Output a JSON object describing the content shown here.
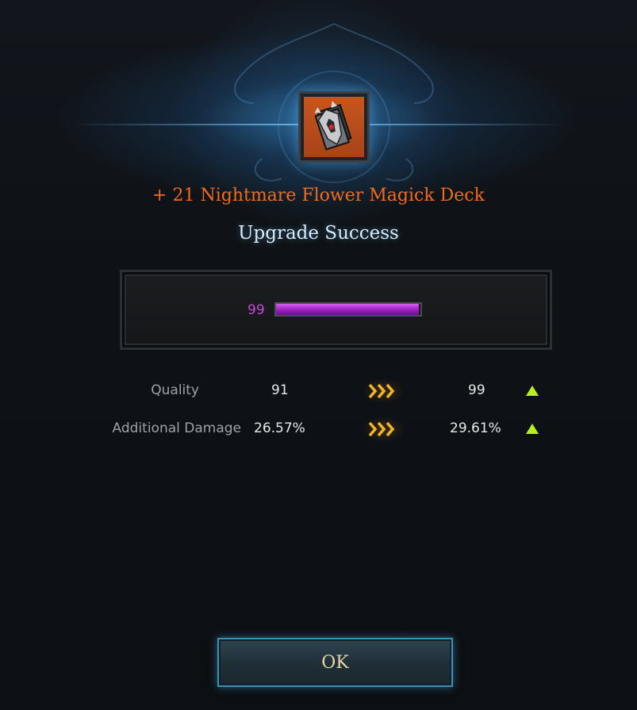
{
  "item": {
    "name": "+ 21 Nightmare Flower Magick Deck",
    "icon": "card-deck-icon"
  },
  "result": {
    "title": "Upgrade Success"
  },
  "quality_bar": {
    "value": "99",
    "fill_fraction": 0.99
  },
  "stats": [
    {
      "label": "Quality",
      "before": "91",
      "after": "99",
      "change": "increase"
    },
    {
      "label": "Additional Damage",
      "before": "26.57%",
      "after": "29.61%",
      "change": "increase"
    }
  ],
  "ok_button": {
    "label": "OK"
  },
  "colors": {
    "item_name": "#f26b1d",
    "title": "#d6ecfb",
    "quality_purple": "#c24ad6",
    "arrow_gold": "#f2b52a",
    "up_green": "#b6f01e"
  }
}
